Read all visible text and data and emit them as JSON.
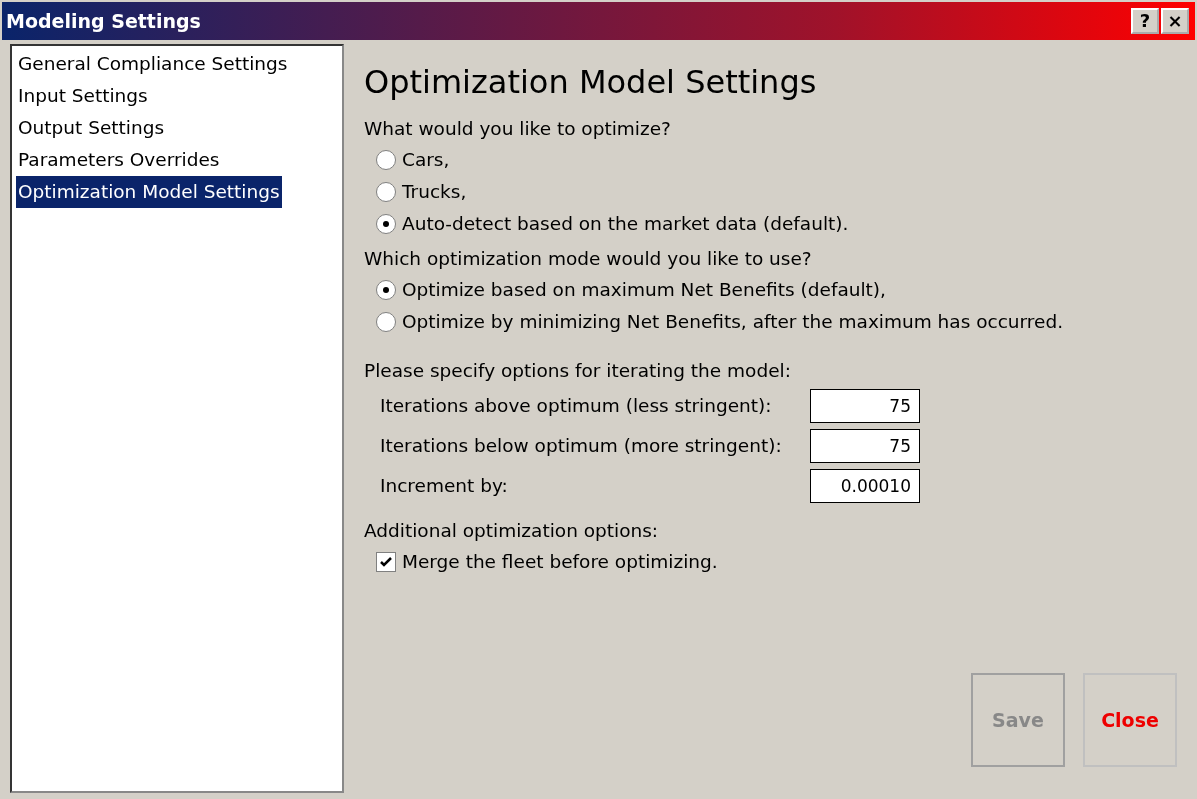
{
  "window": {
    "title": "Modeling Settings",
    "help_button": "?",
    "close_button": "×"
  },
  "sidebar": {
    "items": [
      {
        "label": "General Compliance Settings",
        "selected": false
      },
      {
        "label": "Input Settings",
        "selected": false
      },
      {
        "label": "Output Settings",
        "selected": false
      },
      {
        "label": "Parameters Overrides",
        "selected": false
      },
      {
        "label": "Optimization Model Settings",
        "selected": true
      }
    ]
  },
  "panel": {
    "heading": "Optimization Model Settings",
    "optimize_target": {
      "question": "What would you like to optimize?",
      "options": [
        {
          "label": "Cars,",
          "selected": false
        },
        {
          "label": "Trucks,",
          "selected": false
        },
        {
          "label": "Auto-detect based on the market data (default).",
          "selected": true
        }
      ]
    },
    "optimization_mode": {
      "question": "Which optimization mode would you like to use?",
      "options": [
        {
          "label": "Optimize based on maximum Net Benefits (default),",
          "selected": true
        },
        {
          "label": "Optimize by minimizing Net Benefits, after the maximum has occurred.",
          "selected": false
        }
      ]
    },
    "iteration": {
      "question": "Please specify options for iterating the model:",
      "fields": [
        {
          "label": "Iterations above optimum (less stringent):",
          "value": "75"
        },
        {
          "label": "Iterations below optimum (more stringent):",
          "value": "75"
        },
        {
          "label": "Increment by:",
          "value": "0.00010"
        }
      ]
    },
    "additional": {
      "question": "Additional optimization options:",
      "options": [
        {
          "label": "Merge the fleet before optimizing.",
          "checked": true
        }
      ]
    }
  },
  "buttons": [
    {
      "label": "Save",
      "disabled": true,
      "kind": "save"
    },
    {
      "label": "Close",
      "disabled": false,
      "kind": "close"
    }
  ]
}
